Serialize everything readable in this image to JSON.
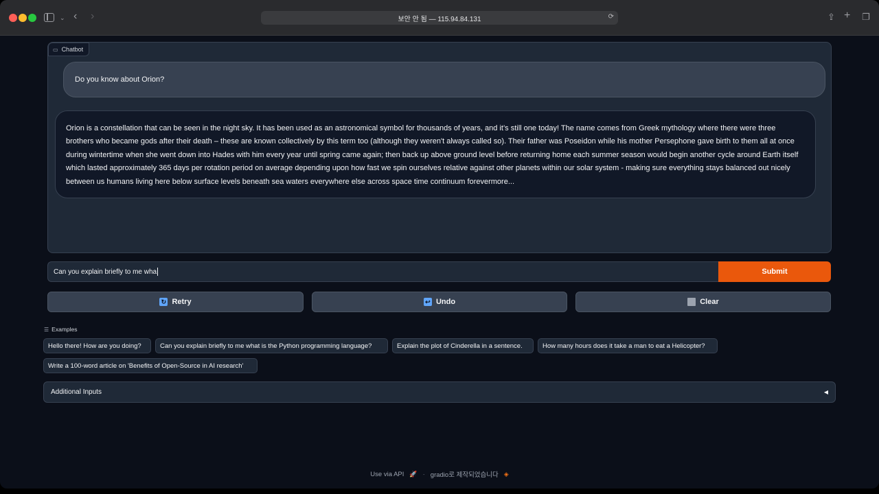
{
  "browser": {
    "address": "보안 안 됨 — 115.94.84.131",
    "accent_close": "#fe5f57",
    "accent_min": "#febc2e",
    "accent_max": "#28c840"
  },
  "chatbot": {
    "label": "Chatbot",
    "label_icon": "chat-icon",
    "messages": [
      {
        "role": "user",
        "text": "Do you know about Orion?"
      },
      {
        "role": "assistant",
        "text": "Orion is a constellation that can be seen in the night sky. It has been used as an astronomical symbol for thousands of years, and it’s still one today! The name comes from Greek mythology where there were three brothers who became gods after their death – these are known collectively by this term too (although they weren't always called so). Their father was Poseidon while his mother Persephone gave birth to them all at once during wintertime when she went down into Hades with him every year until spring came again; then back up above ground level before returning home each summer season would begin another cycle around Earth itself which lasted approximately 365 days per rotation period on average depending upon how fast we spin ourselves relative against other planets within our solar system - making sure everything stays balanced out nicely between us humans living here below surface levels beneath sea waters everywhere else across space time continuum forevermore..."
      }
    ]
  },
  "input": {
    "value": "Can you explain briefly to me wha",
    "submit_label": "Submit",
    "submit_color": "#ea580c"
  },
  "actions": {
    "retry_label": "Retry",
    "retry_icon": "refresh-icon",
    "undo_label": "Undo",
    "undo_icon": "return-arrow-icon",
    "clear_label": "Clear",
    "clear_icon": "trash-icon"
  },
  "examples": {
    "label": "Examples",
    "items": [
      "Hello there! How are you doing?",
      "Can you explain briefly to me what is the Python programming language?",
      "Explain the plot of Cinderella in a sentence.",
      "How many hours does it take a man to eat a Helicopter?",
      "Write a 100-word article on 'Benefits of Open-Source in AI research'"
    ]
  },
  "accordion": {
    "label": "Additional Inputs",
    "caret": "◀"
  },
  "footer": {
    "api_label": "Use via API",
    "separator": "·",
    "built_with": "gradio로 제작되었습니다"
  }
}
